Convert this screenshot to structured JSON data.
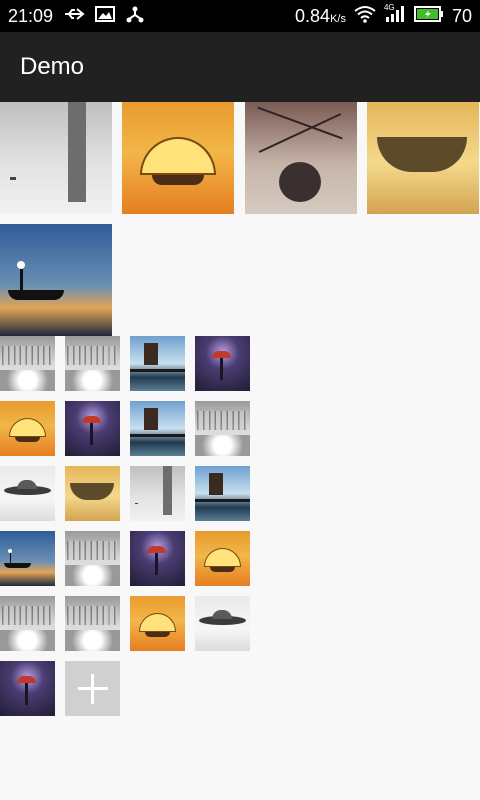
{
  "status": {
    "time": "21:09",
    "net_speed": "0.84",
    "net_unit": "K/s",
    "signal_label": "4G",
    "battery": "70"
  },
  "appbar": {
    "title": "Demo"
  },
  "colors": {
    "status_bg": "#000000",
    "appbar_bg": "#212121",
    "page_bg": "#f8f8f8",
    "add_tile": "#d0d0d0"
  },
  "large_photos": [
    {
      "theme": "tower"
    },
    {
      "theme": "dome"
    },
    {
      "theme": "spider"
    },
    {
      "theme": "island"
    },
    {
      "theme": "sea"
    }
  ],
  "small_photos": [
    [
      "ship",
      "ship",
      "monol",
      "violet"
    ],
    [
      "dome",
      "violet",
      "monol",
      "ship"
    ],
    [
      "saucer",
      "island",
      "tower",
      "monol"
    ],
    [
      "sea",
      "ship",
      "violet",
      "dome"
    ],
    [
      "ship",
      "ship",
      "dome",
      "saucer"
    ],
    [
      "violet"
    ]
  ],
  "add_button": {
    "icon": "plus-icon"
  }
}
